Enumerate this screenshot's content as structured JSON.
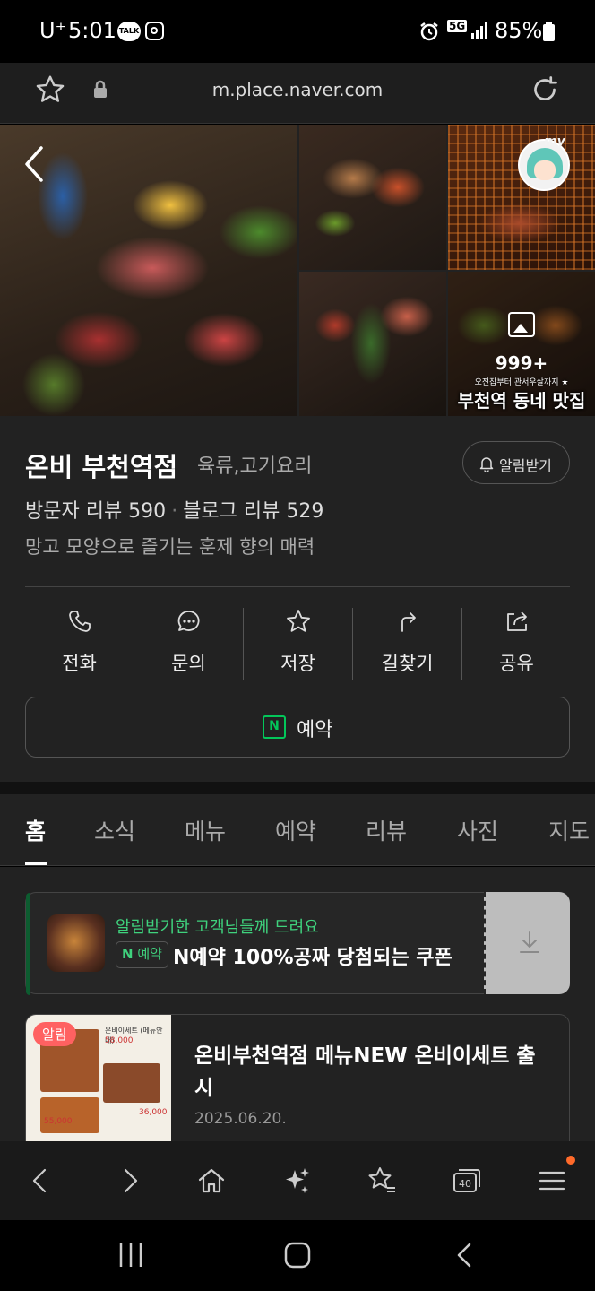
{
  "status_bar": {
    "carrier": "U⁺",
    "time": "5:01",
    "talk_icon": "TALK",
    "network": "5G",
    "battery": "85%"
  },
  "browser": {
    "url": "m.place.naver.com"
  },
  "photos": {
    "count": "999+",
    "caption": "부천역 동네 맛집",
    "caption_small": "오전잡부터 관서우살까지 ★",
    "my_label": "my"
  },
  "place": {
    "name": "온비 부천역점",
    "category": "육류,고기요리",
    "alarm_label": "알림받기",
    "visitor_reviews": "방문자 리뷰 590",
    "separator": "·",
    "blog_reviews": "블로그 리뷰 529",
    "description": "망고 모양으로 즐기는 훈제 향의 매력",
    "actions": [
      {
        "label": "전화",
        "icon": "phone-icon"
      },
      {
        "label": "문의",
        "icon": "chat-icon"
      },
      {
        "label": "저장",
        "icon": "star-icon"
      },
      {
        "label": "길찾기",
        "icon": "directions-icon"
      },
      {
        "label": "공유",
        "icon": "share-icon"
      }
    ],
    "reserve_label": "예약",
    "reserve_icon_text": "N"
  },
  "tabs": [
    "홈",
    "소식",
    "메뉴",
    "예약",
    "리뷰",
    "사진",
    "지도"
  ],
  "active_tab": "홈",
  "coupon": {
    "line1": "알림받기한 고객님들께 드려요",
    "badge_n": "N",
    "badge_text": "예약",
    "line2": "N예약 100%공짜 당첨되는 쿠폰"
  },
  "news": {
    "badge": "알림",
    "title": "온비부천역점 메뉴NEW 온비이세트 출시",
    "date": "2025.06.20.",
    "thumb_text_1": "온비이세트 (메뉴안내)",
    "thumb_text_2": "58,000",
    "thumb_text_3": "55,000",
    "thumb_text_4": "36,000"
  },
  "colors": {
    "accent_green": "#03c75a",
    "badge_red": "#ff6161",
    "notify_dot": "#ff6a2a"
  }
}
